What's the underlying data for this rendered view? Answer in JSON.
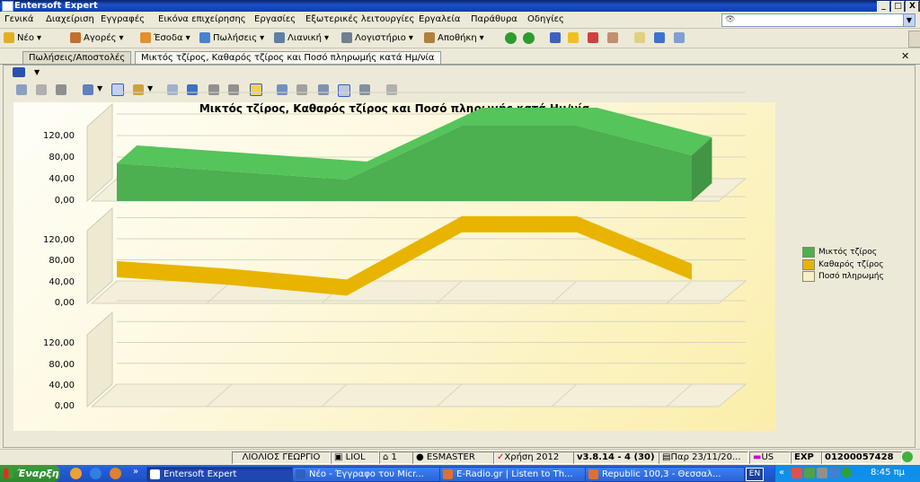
{
  "window": {
    "title": "Entersoft Expert",
    "min": "_",
    "max": "□",
    "close": "X"
  },
  "menu": [
    "Γενικά",
    "Διαχείριση",
    "Εγγραφές",
    "Εικόνα επιχείρησης",
    "Εργασίες",
    "Εξωτερικές λειτουργίες",
    "Εργαλεία",
    "Παράθυρα",
    "Οδηγίες"
  ],
  "toolbar": [
    "Νέο",
    "Αγορές",
    "Έσοδα",
    "Πωλήσεις",
    "Λιανική",
    "Λογιστήριο",
    "Αποθήκη"
  ],
  "tabs": [
    "Πωλήσεις/Αποστολές",
    "Μικτός τζίρος, Καθαρός τζίρος και Ποσό πληρωμής κατά Ημ/νία"
  ],
  "chart_data": {
    "type": "area",
    "title": "Μικτός τζίρος, Καθαρός τζίρος και Ποσό πληρωμής κατά Ημ/νία",
    "ytick_labels": [
      "0,00",
      "40,00",
      "80,00",
      "120,00"
    ],
    "ylim": [
      0,
      160
    ],
    "legend_position": "right",
    "series": [
      {
        "name": "Μικτός τζίρος",
        "color": "#4caf50",
        "values": [
          70,
          55,
          40,
          140,
          140,
          85
        ]
      },
      {
        "name": "Καθαρός τζίρος",
        "color": "#e8b400",
        "values": [
          65,
          50,
          30,
          150,
          150,
          60
        ]
      },
      {
        "name": "Ποσό πληρωμής",
        "color": "#f6f0c4",
        "values": [
          0,
          0,
          0,
          0,
          0,
          0
        ]
      }
    ]
  },
  "status": {
    "user": "ΛΙΟΛΙΟΣ ΓΕΩΡΓΙΟ",
    "company": "LIOL",
    "branch": "1",
    "db": "ESMASTER",
    "fiscal_year": "Χρήση 2012",
    "version": "v3.8.14 - 4 (30)",
    "date": "Παρ 23/11/20...",
    "lang": "US",
    "mode": "EXP",
    "serial": "01200057428"
  },
  "taskbar": {
    "start": "Έναρξη",
    "tasks": [
      "Entersoft Expert",
      "Νέο - Έγγραφο του Micr...",
      "E-Radio.gr | Listen to Th...",
      "Republic 100,3 - Θεσσαλ..."
    ],
    "lang": "EN",
    "clock": "8:45 πμ"
  }
}
